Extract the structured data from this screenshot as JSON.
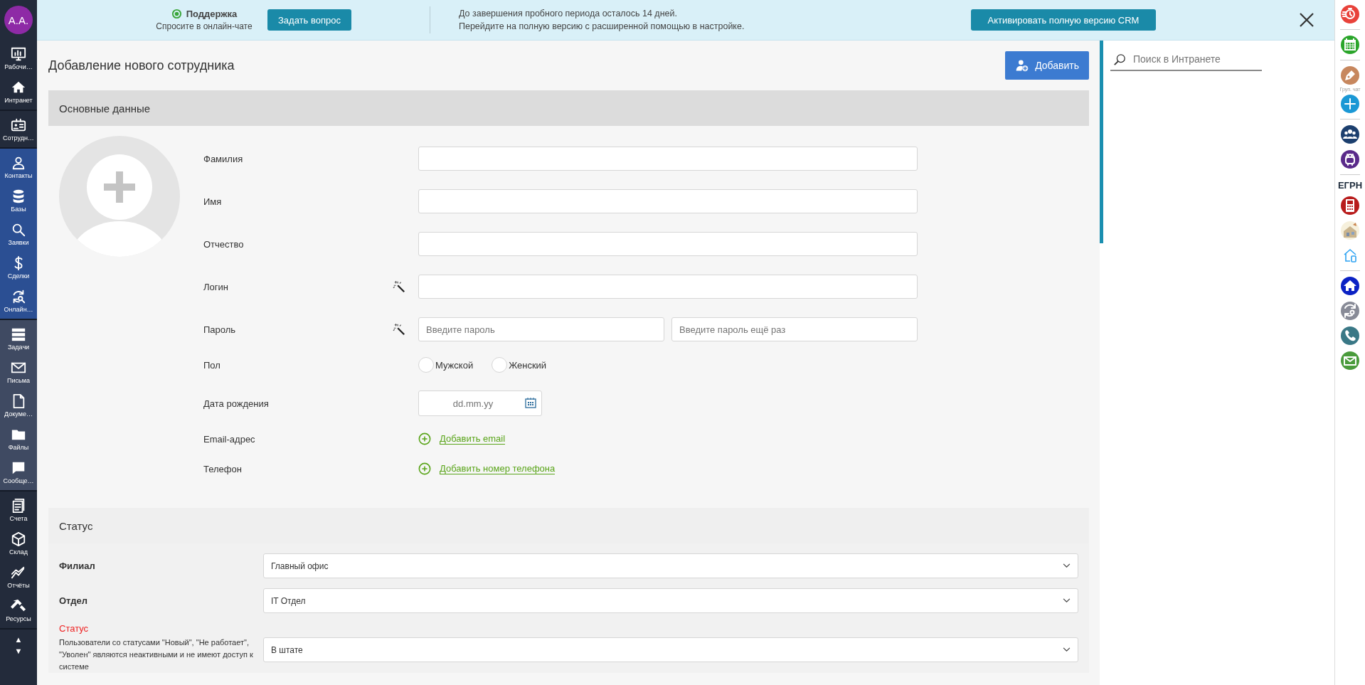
{
  "sidebar": {
    "avatar": "A.A.",
    "groups": [
      {
        "kind": "dark",
        "items": [
          {
            "kind": "dashboard",
            "label": "Рабочи…"
          },
          {
            "kind": "home",
            "label": "Интранет"
          }
        ]
      },
      {
        "kind": "dark",
        "items": [
          {
            "kind": "idcard",
            "label": "Сотрудн…"
          }
        ]
      },
      {
        "kind": "blue",
        "items": [
          {
            "kind": "person",
            "label": "Контакты"
          },
          {
            "kind": "database",
            "label": "Базы"
          },
          {
            "kind": "search",
            "label": "Заявки"
          },
          {
            "kind": "dollar",
            "label": "Сделки"
          },
          {
            "kind": "refresh",
            "label": "Онлайн…"
          }
        ]
      },
      {
        "kind": "slate",
        "items": [
          {
            "kind": "list",
            "label": "Задачи"
          },
          {
            "kind": "mail",
            "label": "Письма"
          },
          {
            "kind": "document",
            "label": "Докуме…"
          },
          {
            "kind": "folder",
            "label": "Файлы"
          },
          {
            "kind": "chat",
            "label": "Сообще…"
          }
        ]
      },
      {
        "kind": "dark",
        "items": [
          {
            "kind": "clipboard",
            "label": "Счета"
          },
          {
            "kind": "cube",
            "label": "Склад"
          },
          {
            "kind": "chart",
            "label": "Отчёты"
          },
          {
            "kind": "hammer",
            "label": "Ресурсы"
          }
        ]
      }
    ],
    "scroll_up": "▲",
    "scroll_down": "▼"
  },
  "banner": {
    "support_title": "Поддержка",
    "support_subtitle": "Спросите в онлайн-чате",
    "ask_button": "Задать вопрос",
    "trial_lines": [
      "До завершения пробного периода осталось 14 дней.",
      "Перейдите на полную версию с расширенной помощью в настройке."
    ],
    "activate_button": "Активировать полную версию CRM"
  },
  "page": {
    "title": "Добавление нового сотрудника",
    "add_button": "Добавить"
  },
  "basic": {
    "title": "Основные данные",
    "fields": [
      {
        "kind": "text",
        "label": "Фамилия"
      },
      {
        "kind": "text",
        "label": "Имя"
      },
      {
        "kind": "text",
        "label": "Отчество"
      },
      {
        "kind": "text",
        "label": "Логин",
        "wand": true
      },
      {
        "kind": "password",
        "label": "Пароль",
        "wand": true,
        "placeholders": [
          "Введите пароль",
          "Введите пароль ещё раз"
        ]
      },
      {
        "kind": "radio",
        "label": "Пол",
        "options": [
          {
            "label": "Мужской",
            "selected": false
          },
          {
            "label": "Женский",
            "selected": false
          }
        ]
      },
      {
        "kind": "date",
        "label": "Дата рождения",
        "placeholder": "dd.mm.yy"
      },
      {
        "kind": "add",
        "label": "Email-адрес",
        "link": "Добавить email"
      },
      {
        "kind": "add",
        "label": "Телефон",
        "link": "Добавить номер телефона"
      }
    ]
  },
  "status": {
    "title": "Статус",
    "fields": [
      {
        "label": "Филиал",
        "value": "Главный офис",
        "required": false
      },
      {
        "label": "Отдел",
        "value": "IT Отдел",
        "required": false
      },
      {
        "label": "Статус",
        "value": "В штате",
        "required": true,
        "note": "Пользователи со статусами \"Новый\", \"Не работает\", \"Уволен\" являются неактивными и не имеют доступ к системе"
      }
    ]
  },
  "search": {
    "placeholder": "Поиск в Интранете"
  },
  "right_bar": [
    {
      "kind": "stopwatch",
      "color": "#e8423a"
    },
    {
      "kind": "divider"
    },
    {
      "kind": "calendar",
      "color": "#2aa52a"
    },
    {
      "kind": "divider"
    },
    {
      "kind": "pen",
      "color": "#c7875e"
    },
    {
      "kind": "caption",
      "text": "Груп. чат"
    },
    {
      "kind": "plus",
      "color": "#1b98d5"
    },
    {
      "kind": "divider"
    },
    {
      "kind": "people",
      "color": "#1c3f6e"
    },
    {
      "kind": "robot",
      "color": "#5a2a8a"
    },
    {
      "kind": "divider"
    },
    {
      "kind": "text",
      "text": "ЕГРН"
    },
    {
      "kind": "phonebook",
      "color": "#b81c1c"
    },
    {
      "kind": "house-art"
    },
    {
      "kind": "house-outline"
    },
    {
      "kind": "divider"
    },
    {
      "kind": "home",
      "color": "#0b22c4"
    },
    {
      "kind": "refresh",
      "color": "#888b97"
    },
    {
      "kind": "phone",
      "color": "#3a7886"
    },
    {
      "kind": "mail",
      "color": "#4a9b3c"
    }
  ]
}
